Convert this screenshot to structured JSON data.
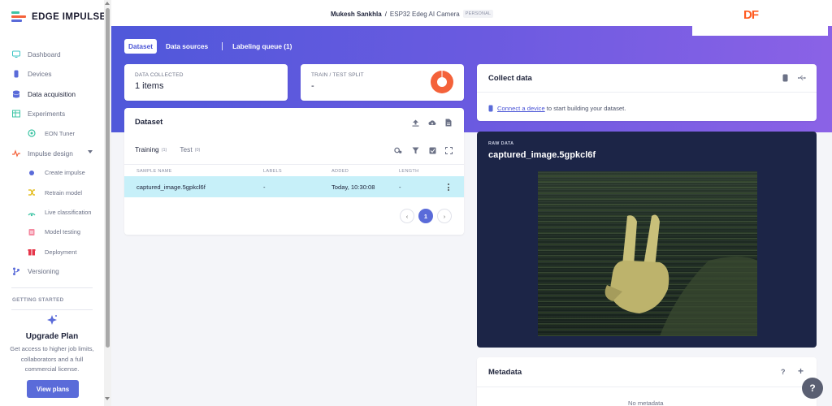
{
  "app": {
    "name": "EDGE IMPULSE"
  },
  "sidebar": {
    "items": [
      {
        "label": "Dashboard",
        "icon": "monitor-icon"
      },
      {
        "label": "Devices",
        "icon": "device-icon"
      },
      {
        "label": "Data acquisition",
        "icon": "database-icon",
        "active": true
      },
      {
        "label": "Experiments",
        "icon": "table-icon"
      },
      {
        "label": "EON Tuner",
        "icon": "tuner-icon"
      },
      {
        "label": "Impulse design",
        "icon": "pulse-icon"
      },
      {
        "label": "Create impulse",
        "icon": "dot-icon"
      },
      {
        "label": "Retrain model",
        "icon": "shuffle-icon"
      },
      {
        "label": "Live classification",
        "icon": "live-icon"
      },
      {
        "label": "Model testing",
        "icon": "test-icon"
      },
      {
        "label": "Deployment",
        "icon": "gift-icon"
      },
      {
        "label": "Versioning",
        "icon": "branch-icon"
      }
    ],
    "getting_started": "GETTING STARTED",
    "upgrade": {
      "title": "Upgrade Plan",
      "desc": "Get access to higher job limits, collaborators and a full commercial license.",
      "button": "View plans"
    }
  },
  "header": {
    "owner": "Mukesh Sankhla",
    "separator": "/",
    "project": "ESP32 Edeg AI Camera",
    "badge": "PERSONAL",
    "brand_mark": "DF"
  },
  "tabs": [
    {
      "label": "Dataset",
      "active": true
    },
    {
      "label": "Data sources"
    },
    {
      "label": "Labeling queue (1)"
    }
  ],
  "stats": {
    "collected_label": "DATA COLLECTED",
    "collected_value": "1 items",
    "split_label": "TRAIN / TEST SPLIT",
    "split_value": "-"
  },
  "dataset": {
    "title": "Dataset",
    "training_label": "Training",
    "training_count": "(1)",
    "test_label": "Test",
    "test_count": "(0)",
    "columns": [
      "SAMPLE NAME",
      "LABELS",
      "ADDED",
      "LENGTH"
    ],
    "rows": [
      {
        "name": "captured_image.5gpkcl6f",
        "labels": "-",
        "added": "Today, 10:30:08",
        "length": "-"
      }
    ],
    "page": "1",
    "prev": "‹",
    "next": "›"
  },
  "collect": {
    "title": "Collect data",
    "link": "Connect a device",
    "text": " to start building your dataset."
  },
  "raw": {
    "label": "RAW DATA",
    "name": "captured_image.5gpkcl6f"
  },
  "metadata": {
    "title": "Metadata",
    "help": "?",
    "add": "+",
    "empty": "No metadata"
  },
  "colors": {
    "accent": "#5a6bd9",
    "banner_start": "#4f58da",
    "banner_end": "#8b62e6",
    "split_chart": "#f4623a",
    "selected_row": "#c7f0f9",
    "raw_bg": "#1c2547",
    "brand_mark": "#ff5a1f"
  }
}
